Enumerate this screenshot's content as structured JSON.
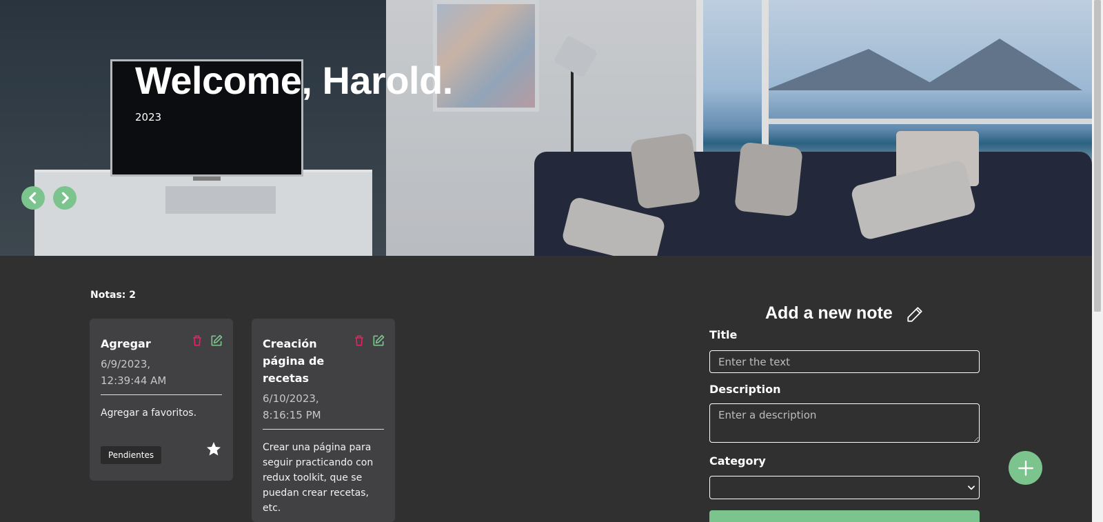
{
  "hero": {
    "title": "Welcome, Harold.",
    "subtitle": "2023",
    "prev_icon": "chevron-left-icon",
    "next_icon": "chevron-right-icon"
  },
  "notes": {
    "count_label": "Notas: 2",
    "items": [
      {
        "title": "Agregar",
        "date": "6/9/2023, 12:39:44 AM",
        "description": "Agregar a favoritos.",
        "category": "Pendientes",
        "favorite": true
      },
      {
        "title": "Creación página de recetas",
        "date": "6/10/2023, 8:16:15 PM",
        "description": "Crear una página para seguir practicando con redux toolkit, que se puedan crear recetas, etc.",
        "category": "",
        "favorite": false
      }
    ]
  },
  "form": {
    "heading": "Add a new note",
    "title_label": "Title",
    "title_placeholder": "Enter the text",
    "description_label": "Description",
    "description_placeholder": "Enter a description",
    "category_label": "Category",
    "category_value": ""
  },
  "colors": {
    "accent": "#7cc48e",
    "background": "#303030",
    "card": "#414144",
    "delete": "#e0245e"
  }
}
